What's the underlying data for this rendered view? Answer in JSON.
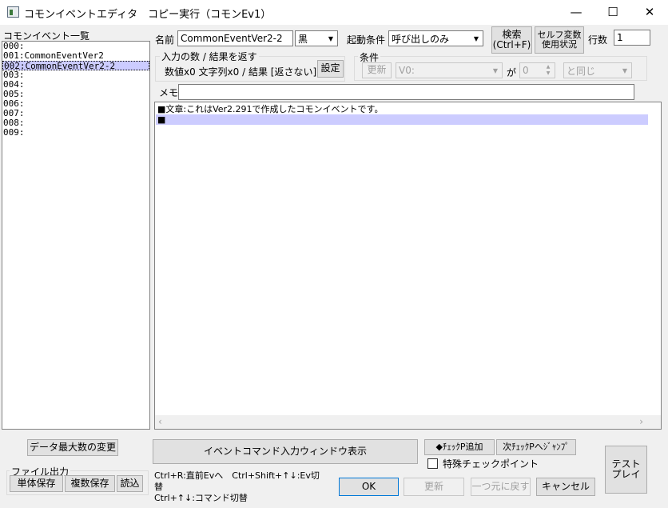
{
  "window": {
    "title": "コモンイベントエディタ　コピー実行（コモンEv1）",
    "minimize": "—",
    "maximize": "☐",
    "close": "✕"
  },
  "left": {
    "list_label": "コモンイベント一覧",
    "items": [
      "000:",
      "001:CommonEventVer2",
      "002:CommonEventVer2-2",
      "003:",
      "004:",
      "005:",
      "006:",
      "007:",
      "008:",
      "009:"
    ],
    "selected_index": 2
  },
  "header": {
    "name_label": "名前",
    "name_value": "CommonEventVer2-2",
    "color_value": "黒",
    "trigger_label": "起動条件",
    "trigger_value": "呼び出しのみ",
    "search_label_1": "検索",
    "search_label_2": "(Ctrl+F)",
    "self_var_label_1": "セルフ変数",
    "self_var_label_2": "使用状況",
    "lines_label": "行数",
    "lines_value": "1"
  },
  "io_group": {
    "title": "入力の数 / 結果を返す",
    "summary": "数値x0 文字列x0 / 結果 [返さない]",
    "settings_button": "設定"
  },
  "condition_group": {
    "title": "条件",
    "update_button": "更新",
    "variable_value": "V0:",
    "ga_label": "が",
    "number_value": "0",
    "compare_value": "と同じ"
  },
  "memo": {
    "label": "メモ",
    "value": ""
  },
  "commands": [
    "■文章:これはVer2.291で作成したコモンイベントです。",
    "■"
  ],
  "selected_command": 1,
  "bottom": {
    "max_data_button": "データ最大数の変更",
    "file_output_title": "ファイル出力",
    "save_single_button": "単体保存",
    "save_multi_button": "複数保存",
    "load_button": "読込",
    "cmd_input_button": "イベントコマンド入力ウィンドウ表示",
    "shortcut_line1": "Ctrl+R:直前Evへ　Ctrl+Shift+↑↓:Ev切替",
    "shortcut_line2": "Ctrl+↑↓:コマンド切替",
    "add_check_button": "◆ﾁｪｯｸP追加",
    "next_check_button": "次ﾁｪｯｸPへｼﾞｬﾝﾌﾟ",
    "special_check_label": "特殊チェックポイント",
    "ok_button": "OK",
    "update_button": "更新",
    "undo_button": "一つ元に戻す",
    "cancel_button": "キャンセル",
    "test_play_label_1": "テスト",
    "test_play_label_2": "プレイ"
  }
}
